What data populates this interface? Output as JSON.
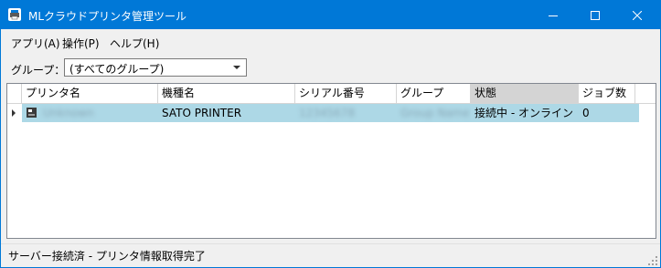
{
  "window": {
    "title": "MLクラウドプリンタ管理ツール",
    "icon": "printer-app-icon"
  },
  "menu": {
    "items": [
      {
        "label": "アプリ(A)"
      },
      {
        "label": "操作(P)"
      },
      {
        "label": "ヘルプ(H)"
      }
    ]
  },
  "group_filter": {
    "label": "グループ：",
    "selected": "(すべてのグループ)"
  },
  "table": {
    "columns": [
      {
        "label": "プリンタ名"
      },
      {
        "label": "機種名"
      },
      {
        "label": "シリアル番号"
      },
      {
        "label": "グループ"
      },
      {
        "label": "状態",
        "sorted": true
      },
      {
        "label": "ジョブ数"
      }
    ],
    "rows": [
      {
        "printer_name": "Unknown",
        "model": "SATO PRINTER",
        "serial": "12345678",
        "group": "Group Name",
        "status": "接続中 - オンライン",
        "jobs": "0",
        "selected": true
      }
    ]
  },
  "status_bar": {
    "text": "サーバー接続済 - プリンタ情報取得完了"
  },
  "colors": {
    "titlebar": "#0078d7",
    "row_selected": "#add8e6",
    "sorted_header": "#d4d4d4"
  }
}
